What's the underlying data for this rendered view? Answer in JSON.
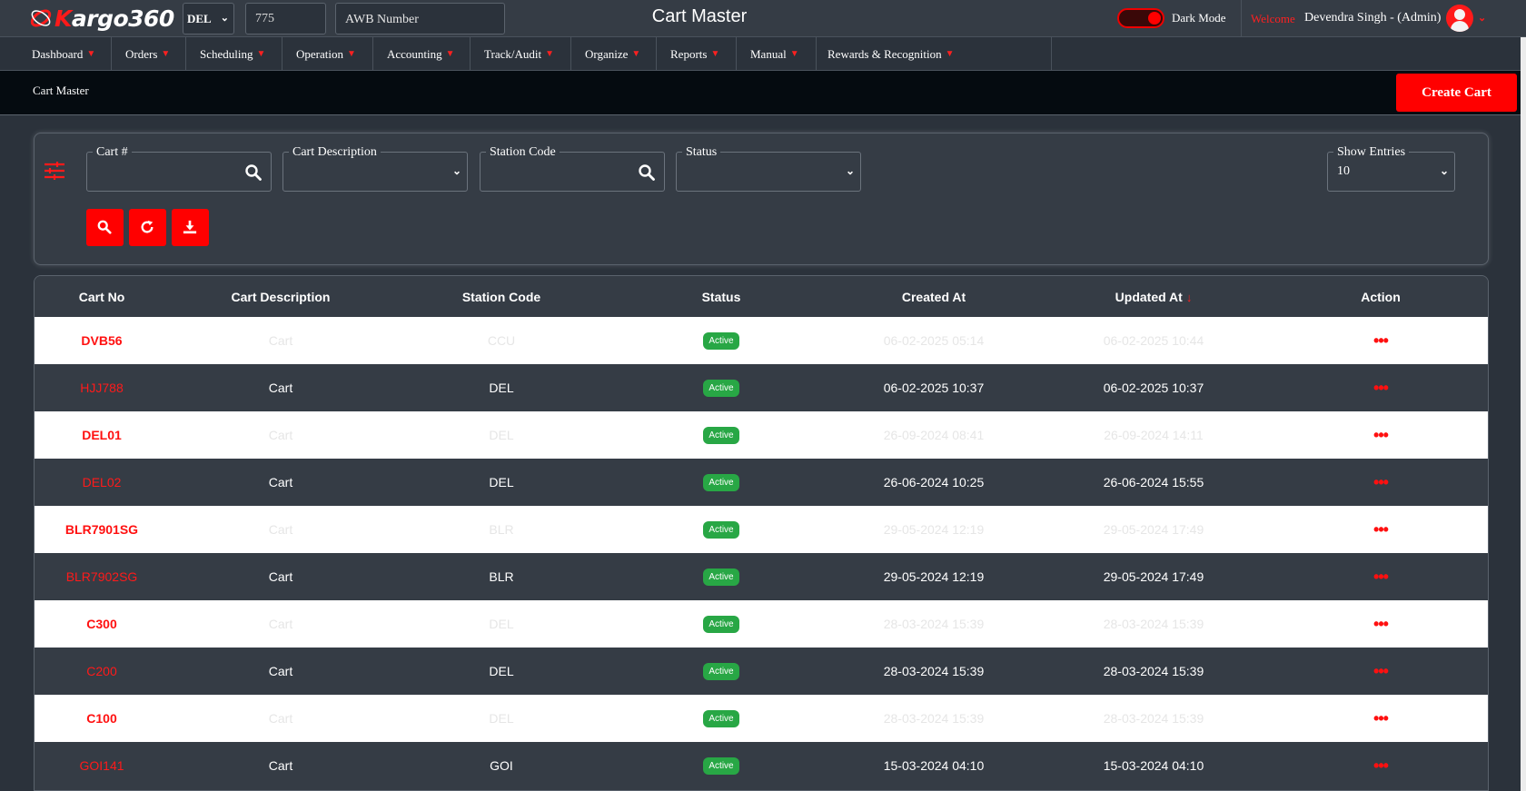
{
  "header": {
    "brand_k": "K",
    "brand_rest": "argo360",
    "station": "DEL",
    "awb_prefix": "775",
    "awb_number": "AWB Number",
    "title": "Cart Master",
    "dark_mode_label": "Dark Mode",
    "welcome": "Welcome",
    "user": "Devendra Singh - (Admin)"
  },
  "nav": [
    {
      "label": "Dashboard"
    },
    {
      "label": "Orders"
    },
    {
      "label": "Scheduling"
    },
    {
      "label": "Operation"
    },
    {
      "label": "Accounting"
    },
    {
      "label": "Track/Audit"
    },
    {
      "label": "Organize"
    },
    {
      "label": "Reports"
    },
    {
      "label": "Manual"
    },
    {
      "label": "Rewards & Recognition"
    }
  ],
  "breadcrumb": "Cart Master",
  "create_button": "Create Cart",
  "filters": {
    "cart_no_label": "Cart #",
    "cart_desc_label": "Cart Description",
    "station_label": "Station Code",
    "status_label": "Status",
    "entries_label": "Show Entries",
    "entries_value": "10"
  },
  "table": {
    "headers": [
      "Cart No",
      "Cart Description",
      "Station Code",
      "Status",
      "Created At",
      "Updated At",
      "Action"
    ],
    "rows": [
      {
        "cart_no": "DVB56",
        "desc": "Cart",
        "station": "CCU",
        "status": "Active",
        "created": "06-02-2025 05:14",
        "updated": "06-02-2025 10:44"
      },
      {
        "cart_no": "HJJ788",
        "desc": "Cart",
        "station": "DEL",
        "status": "Active",
        "created": "06-02-2025 10:37",
        "updated": "06-02-2025 10:37"
      },
      {
        "cart_no": "DEL01",
        "desc": "Cart",
        "station": "DEL",
        "status": "Active",
        "created": "26-09-2024 08:41",
        "updated": "26-09-2024 14:11"
      },
      {
        "cart_no": "DEL02",
        "desc": "Cart",
        "station": "DEL",
        "status": "Active",
        "created": "26-06-2024 10:25",
        "updated": "26-06-2024 15:55"
      },
      {
        "cart_no": "BLR7901SG",
        "desc": "Cart",
        "station": "BLR",
        "status": "Active",
        "created": "29-05-2024 12:19",
        "updated": "29-05-2024 17:49"
      },
      {
        "cart_no": "BLR7902SG",
        "desc": "Cart",
        "station": "BLR",
        "status": "Active",
        "created": "29-05-2024 12:19",
        "updated": "29-05-2024 17:49"
      },
      {
        "cart_no": "C300",
        "desc": "Cart",
        "station": "DEL",
        "status": "Active",
        "created": "28-03-2024 15:39",
        "updated": "28-03-2024 15:39"
      },
      {
        "cart_no": "C200",
        "desc": "Cart",
        "station": "DEL",
        "status": "Active",
        "created": "28-03-2024 15:39",
        "updated": "28-03-2024 15:39"
      },
      {
        "cart_no": "C100",
        "desc": "Cart",
        "station": "DEL",
        "status": "Active",
        "created": "28-03-2024 15:39",
        "updated": "28-03-2024 15:39"
      },
      {
        "cart_no": "GOI141",
        "desc": "Cart",
        "station": "GOI",
        "status": "Active",
        "created": "15-03-2024 04:10",
        "updated": "15-03-2024 04:10"
      }
    ],
    "action_glyph": "•••"
  },
  "colors": {
    "accent": "#ff0000",
    "panel": "#353c45",
    "background": "#2b323b",
    "status_active": "#28a745"
  }
}
